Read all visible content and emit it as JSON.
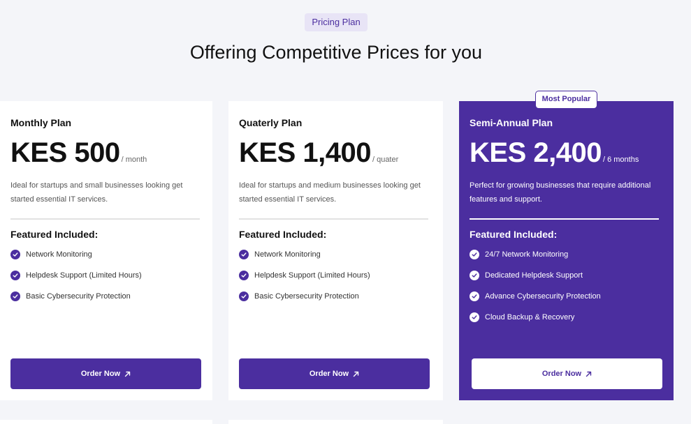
{
  "section": {
    "badge": "Pricing Plan",
    "title": "Offering Competitive Prices for you"
  },
  "plans": [
    {
      "name": "Monthly Plan",
      "price": "KES 500",
      "period": "/ month",
      "description": "Ideal for startups and small businesses looking get started essential IT services.",
      "features_title": "Featured Included:",
      "features": [
        "Network Monitoring",
        "Helpdesk Support (Limited Hours)",
        "Basic Cybersecurity Protection"
      ],
      "button": "Order Now"
    },
    {
      "name": "Quaterly Plan",
      "price": "KES 1,400",
      "period": "/ quater",
      "description": "Ideal for startups and medium businesses looking get started essential IT services.",
      "features_title": "Featured Included:",
      "features": [
        "Network Monitoring",
        "Helpdesk Support (Limited Hours)",
        "Basic Cybersecurity Protection"
      ],
      "button": "Order Now"
    },
    {
      "name": "Semi-Annual Plan",
      "price": "KES 2,400",
      "period": "/ 6 months",
      "description": "Perfect for growing businesses that require additional features and support.",
      "features_title": "Featured Included:",
      "features": [
        "24/7 Network Monitoring",
        "Dedicated Helpdesk Support",
        "Advance Cybersecurity Protection",
        "Cloud Backup & Recovery"
      ],
      "button": "Order Now",
      "badge": "Most Popular"
    }
  ],
  "colors": {
    "accent": "#4b2e9f",
    "badge_bg": "#e8e4f6",
    "page_bg": "#f4f5f9"
  },
  "icons": {
    "feature": "check-circle-icon",
    "button": "arrow-up-right-icon"
  }
}
